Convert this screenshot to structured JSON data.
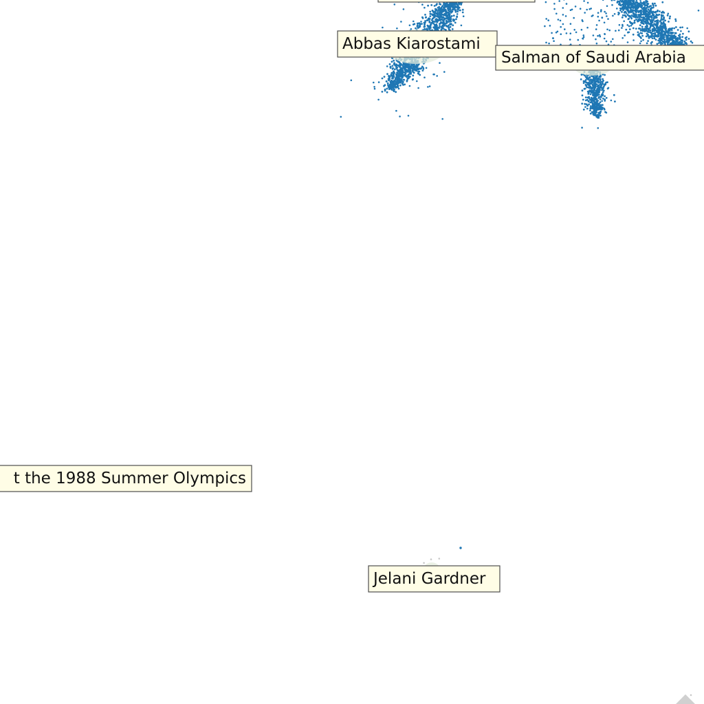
{
  "chart_data": {
    "type": "scatter",
    "title": "",
    "xlabel": "",
    "ylabel": "",
    "axes_visible": false,
    "grid": false,
    "point_color": "#1f77b4",
    "label_background": "#fffde6",
    "labels": [
      {
        "text": "Abbas Kiarostami"
      },
      {
        "text": "Salman of Saudi Arabia"
      },
      {
        "text": "t the 1988 Summer Olympics"
      },
      {
        "text": "Jelani Gardner"
      },
      {
        "text": ""
      }
    ]
  }
}
